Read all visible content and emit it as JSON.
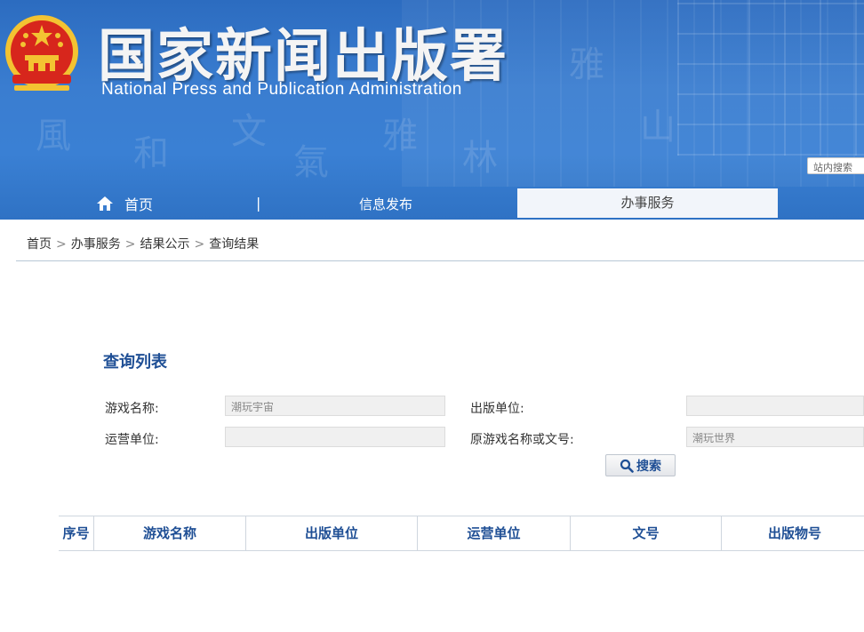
{
  "header": {
    "title": "国家新闻出版署",
    "subtitle": "National  Press and Publication Administration",
    "site_search_placeholder": "站内搜索"
  },
  "nav": {
    "home": "首页",
    "separator": "|",
    "info": "信息发布",
    "service": "办事服务"
  },
  "breadcrumb": {
    "items": [
      "首页",
      "办事服务",
      "结果公示",
      "查询结果"
    ],
    "separator": ">"
  },
  "query": {
    "section_title": "查询列表",
    "fields": {
      "game_name": {
        "label": "游戏名称:",
        "value": "潮玩宇宙"
      },
      "publisher": {
        "label": "出版单位:",
        "value": ""
      },
      "operator": {
        "label": "运营单位:",
        "value": ""
      },
      "original_name": {
        "label": "原游戏名称或文号:",
        "value": "潮玩世界"
      }
    },
    "search_button": "搜索"
  },
  "table": {
    "columns": [
      "序号",
      "游戏名称",
      "出版单位",
      "运营单位",
      "文号",
      "出版物号"
    ]
  },
  "colors": {
    "banner_blue": "#3a7dd0",
    "accent_text": "#1f4f95",
    "nav_active_bg": "#f2f5fa",
    "emblem_red": "#d7261c",
    "emblem_gold": "#f3c332"
  },
  "icons": {
    "emblem": "national-emblem",
    "home": "home-icon",
    "search": "magnifier-icon"
  }
}
